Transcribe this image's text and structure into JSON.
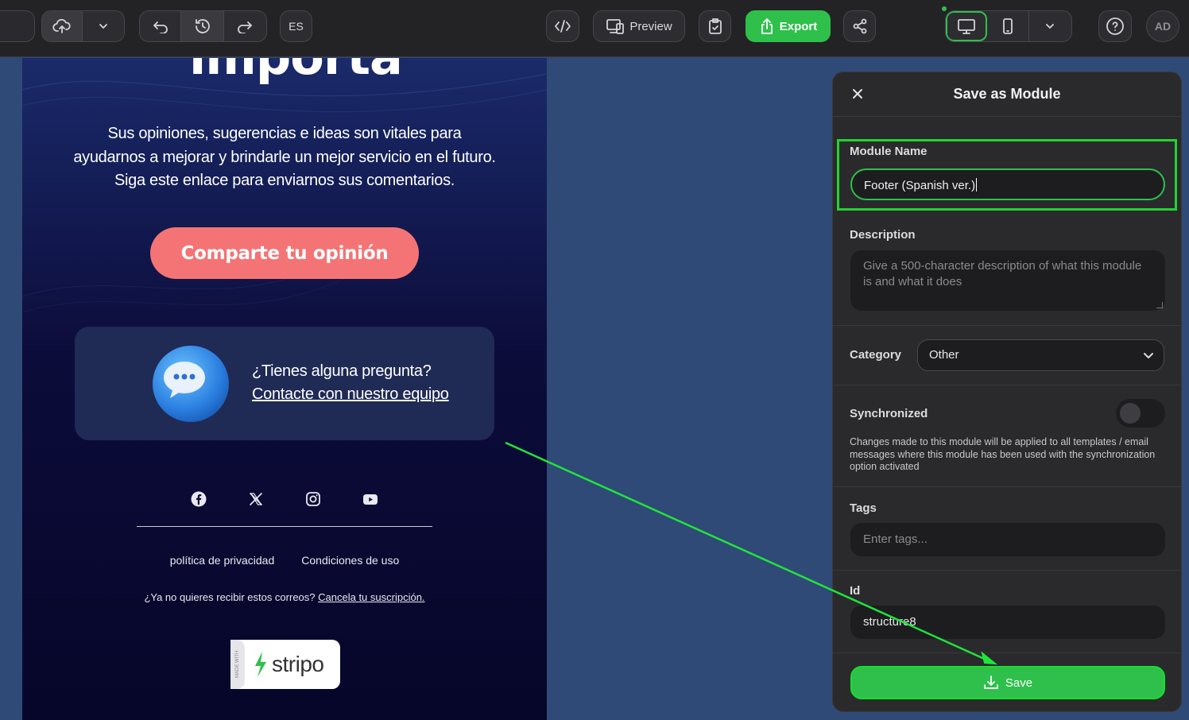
{
  "toolbar": {
    "language_label": "ES",
    "preview_label": "Preview",
    "export_label": "Export",
    "avatar_initials": "AD",
    "icons": [
      "cloud-upload-icon",
      "chevron-down-icon",
      "undo-icon",
      "history-icon",
      "redo-icon",
      "code-icon",
      "preview-devices-icon",
      "clipboard-check-icon",
      "export-upload-icon",
      "share-icon",
      "desktop-icon",
      "mobile-icon",
      "chevron-down-icon",
      "help-icon"
    ],
    "active_device": "desktop",
    "accent": "#2ec04b"
  },
  "email": {
    "headline_fragment": "importa",
    "intro_text": "Sus opiniones, sugerencias e ideas son vitales para ayudarnos a mejorar y brindarle un mejor servicio en el futuro. Siga este enlace para enviarnos sus comentarios.",
    "cta_label": "Comparte tu opinión",
    "question_text": "¿Tienes alguna pregunta?",
    "contact_link": "Contacte con nuestro equipo",
    "social_icons": [
      "facebook-icon",
      "x-icon",
      "instagram-icon",
      "youtube-icon"
    ],
    "privacy_link": "política de privacidad",
    "terms_link": "Condiciones de uso",
    "unsubscribe_text": "¿Ya no quieres recibir estos correos?",
    "unsubscribe_link": "Cancela tu suscripción.",
    "badge_made_with": "MADE WITH",
    "badge_brand": "stripo",
    "background": "#0b0b34",
    "cta_color": "#f47475"
  },
  "panel": {
    "title": "Save as Module",
    "module_name_label": "Module Name",
    "module_name_value": "Footer (Spanish ver.)",
    "description_label": "Description",
    "description_placeholder": "Give a 500-character description of what this module is and what it does",
    "category_label": "Category",
    "category_value": "Other",
    "synchronized_label": "Synchronized",
    "synchronized_on": false,
    "synchronized_note": "Changes made to this module will be applied to all templates / email messages where this module has been used with the synchronization option activated",
    "tags_label": "Tags",
    "tags_placeholder": "Enter tags...",
    "id_label": "Id",
    "id_value": "structure8",
    "save_label": "Save"
  }
}
